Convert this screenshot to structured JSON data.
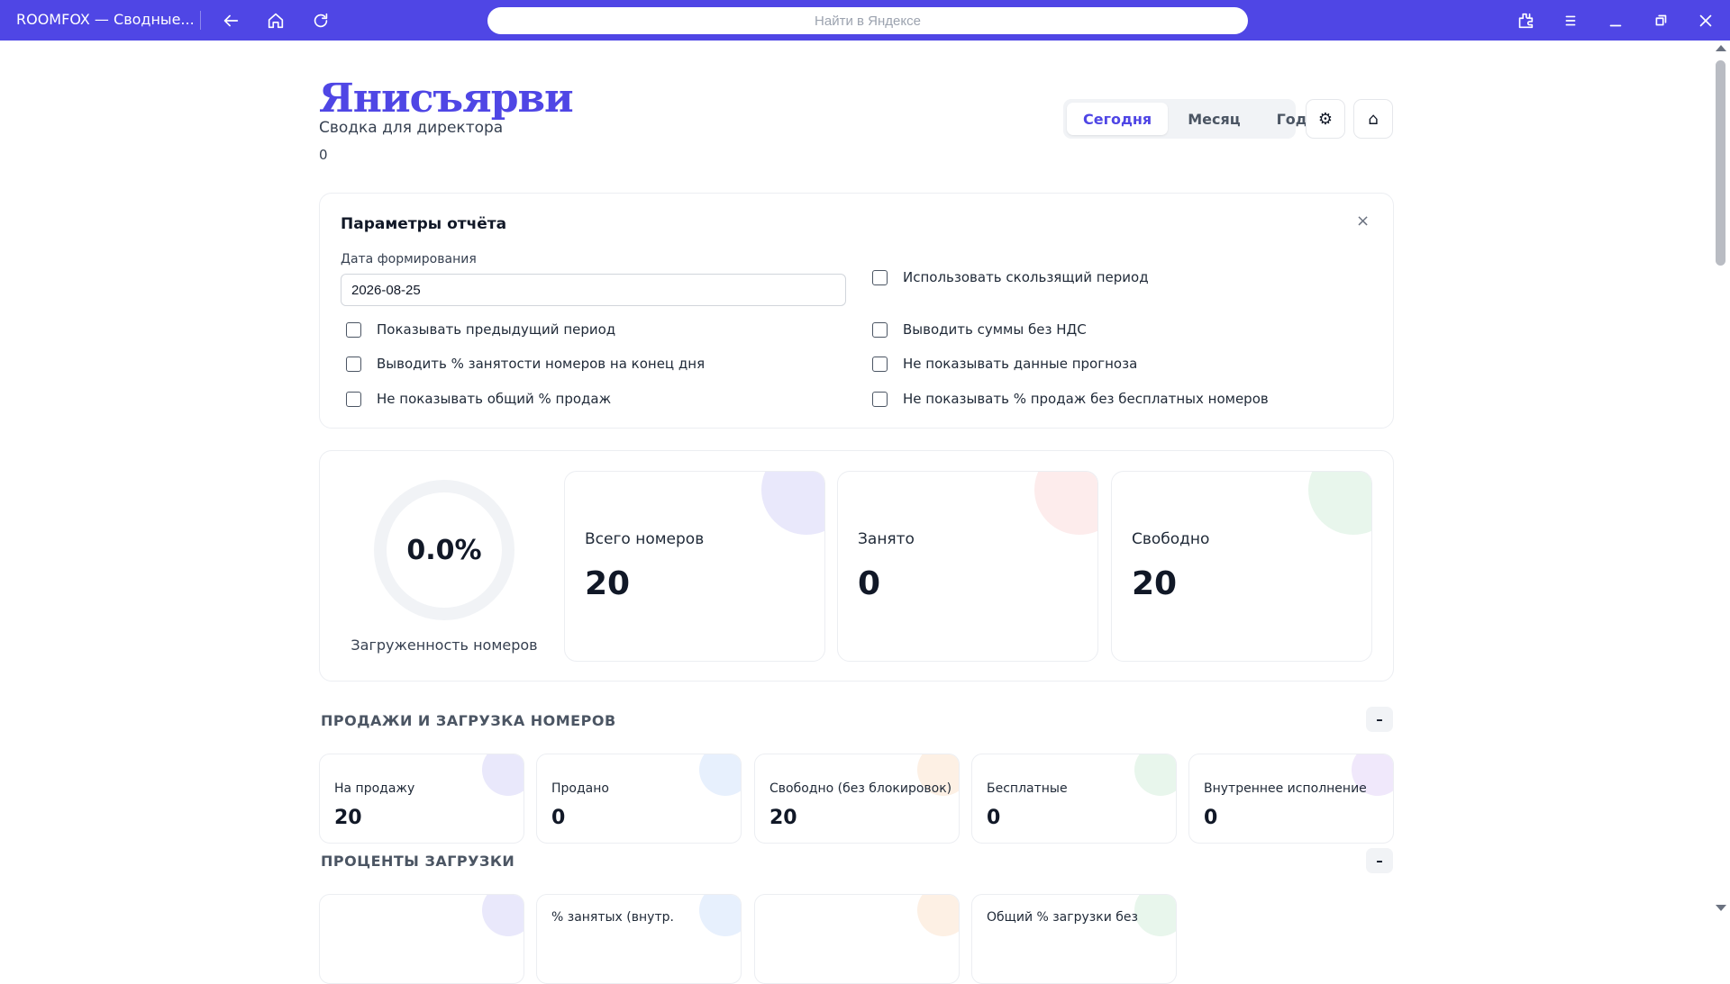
{
  "browser": {
    "tab_title": "ROOMFOX — Сводные...",
    "address_placeholder": "Найти в Яндексе"
  },
  "header": {
    "brand": "Янисъярви",
    "subtitle": "Сводка для директора",
    "counter": "0",
    "periods": [
      "Сегодня",
      "Месяц",
      "Год"
    ],
    "active_period": "Сегодня",
    "settings_icon": "⚙",
    "home_icon": "⌂"
  },
  "params": {
    "title": "Параметры отчёта",
    "close": "×",
    "date_label": "Дата формирования",
    "date_value": "2026-08-25",
    "options": [
      "Использовать скользящий период",
      "Показывать предыдущий период",
      "Выводить суммы без НДС",
      "Выводить % занятости номеров на конец дня",
      "Не показывать данные прогноза",
      "Не показывать общий % продаж",
      "Не показывать % продаж без бесплатных номеров"
    ]
  },
  "occupancy": {
    "percent": "0.0%",
    "label": "Загруженность номеров",
    "stats": [
      {
        "label": "Всего номеров",
        "value": "20",
        "color": "#e9e8fb"
      },
      {
        "label": "Занято",
        "value": "0",
        "color": "#fdecec"
      },
      {
        "label": "Свободно",
        "value": "20",
        "color": "#e8f6ec"
      }
    ]
  },
  "sales": {
    "title": "ПРОДАЖИ И ЗАГРУЗКА НОМЕРОВ",
    "collapse": "–",
    "cards": [
      {
        "label": "На продажу",
        "value": "20",
        "color": "#e9e8fb"
      },
      {
        "label": "Продано",
        "value": "0",
        "color": "#e7f0fd"
      },
      {
        "label": "Свободно (без блокировок)",
        "value": "20",
        "color": "#fdf0e4"
      },
      {
        "label": "Бесплатные",
        "value": "0",
        "color": "#e8f6ec"
      },
      {
        "label": "Внутреннее исполнение",
        "value": "0",
        "color": "#f0e8fb"
      }
    ]
  },
  "percents": {
    "title": "ПРОЦЕНТЫ ЗАГРУЗКИ",
    "collapse": "–",
    "cards": [
      {
        "label": "",
        "color": "#e9e8fb"
      },
      {
        "label": "% занятых (внутр.",
        "color": "#e7f0fd"
      },
      {
        "label": "",
        "color": "#fdf0e4"
      },
      {
        "label": "Общий % загрузки без",
        "color": "#e8f6ec"
      }
    ]
  }
}
